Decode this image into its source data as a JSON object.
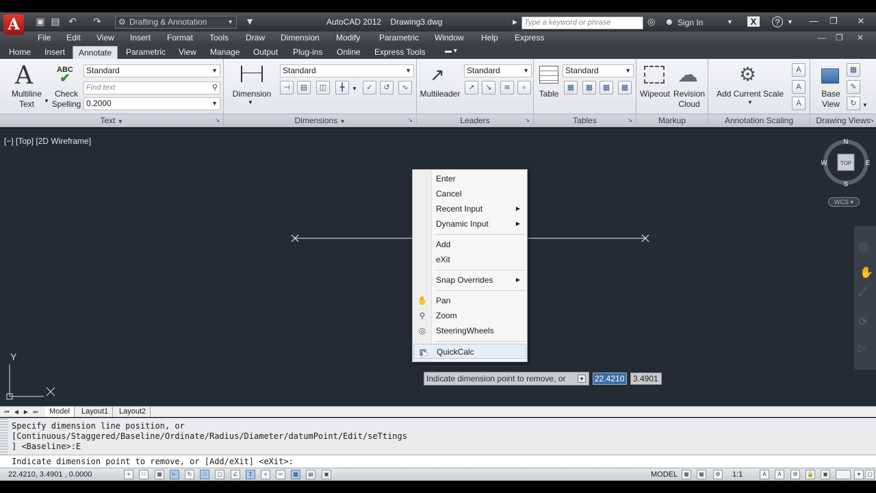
{
  "window": {
    "app_title": "AutoCAD 2012",
    "document": "Drawing3.dwg",
    "workspace": "Drafting & Annotation",
    "search_placeholder": "Type a keyword or phrase",
    "sign_in": "Sign In"
  },
  "menu": [
    "File",
    "Edit",
    "View",
    "Insert",
    "Format",
    "Tools",
    "Draw",
    "Dimension",
    "Modify",
    "Parametric",
    "Window",
    "Help",
    "Express"
  ],
  "ribbon_tabs": [
    "Home",
    "Insert",
    "Annotate",
    "Parametric",
    "View",
    "Manage",
    "Output",
    "Plug-ins",
    "Online",
    "Express Tools"
  ],
  "active_tab": "Annotate",
  "ribbon": {
    "text_panel": {
      "multiline_text": "Multiline Text",
      "multiline_line1": "Multiline",
      "multiline_line2": "Text",
      "check_line1": "Check",
      "check_line2": "Spelling",
      "abc_glyph": "ABC",
      "style_value": "Standard",
      "find_placeholder": "Find text",
      "height_value": "0.2000",
      "title": "Text"
    },
    "dimensions_panel": {
      "dimension_label": "Dimension",
      "style_value": "Standard",
      "title": "Dimensions"
    },
    "leaders_panel": {
      "multileader_label": "Multileader",
      "style_value": "Standard",
      "title": "Leaders"
    },
    "tables_panel": {
      "table_label": "Table",
      "style_value": "Standard",
      "title": "Tables"
    },
    "markup_panel": {
      "wipeout_label": "Wipeout",
      "revision_line1": "Revision",
      "revision_line2": "Cloud",
      "title": "Markup"
    },
    "annotation_scaling_panel": {
      "add_scale_label": "Add Current Scale",
      "title": "Annotation Scaling"
    },
    "drawing_views_panel": {
      "base_line1": "Base",
      "base_line2": "View",
      "title": "Drawing Views"
    }
  },
  "viewport": {
    "label": "[−] [Top] [2D Wireframe]",
    "viewcube_face": "TOP",
    "compass": {
      "n": "N",
      "s": "S",
      "e": "E",
      "w": "W"
    },
    "wcs": "WCS",
    "ucs_y": "Y"
  },
  "context_menu": [
    {
      "label": "Enter",
      "submenu": false,
      "icon": ""
    },
    {
      "label": "Cancel",
      "submenu": false,
      "icon": ""
    },
    {
      "label": "Recent Input",
      "submenu": true,
      "icon": ""
    },
    {
      "label": "Dynamic Input",
      "submenu": true,
      "icon": ""
    },
    {
      "label": "Add",
      "submenu": false,
      "icon": ""
    },
    {
      "label": "eXit",
      "submenu": false,
      "icon": ""
    },
    {
      "label": "Snap Overrides",
      "submenu": true,
      "icon": ""
    },
    {
      "label": "Pan",
      "submenu": false,
      "icon": "pan-icon"
    },
    {
      "label": "Zoom",
      "submenu": false,
      "icon": "zoom-icon"
    },
    {
      "label": "SteeringWheels",
      "submenu": false,
      "icon": "steering-wheel-icon"
    },
    {
      "label": "QuickCalc",
      "submenu": false,
      "icon": "calculator-icon"
    }
  ],
  "dynamic_input": {
    "prompt": "Indicate dimension point to remove, or",
    "x_value": "22.4210",
    "y_value": "3.4901"
  },
  "layout_tabs": [
    "Model",
    "Layout1",
    "Layout2"
  ],
  "command_history": [
    "Specify dimension line position, or",
    "[Continuous/Staggered/Baseline/Ordinate/Radius/Diameter/datumPoint/Edit/seTtings",
    "] <Baseline>:E"
  ],
  "command_line": "Indicate dimension point to remove, or [Add/eXit] <eXit>:",
  "status": {
    "coordinates": "22.4210, 3.4901 , 0.0000",
    "model": "MODEL",
    "scale": "1:1"
  }
}
